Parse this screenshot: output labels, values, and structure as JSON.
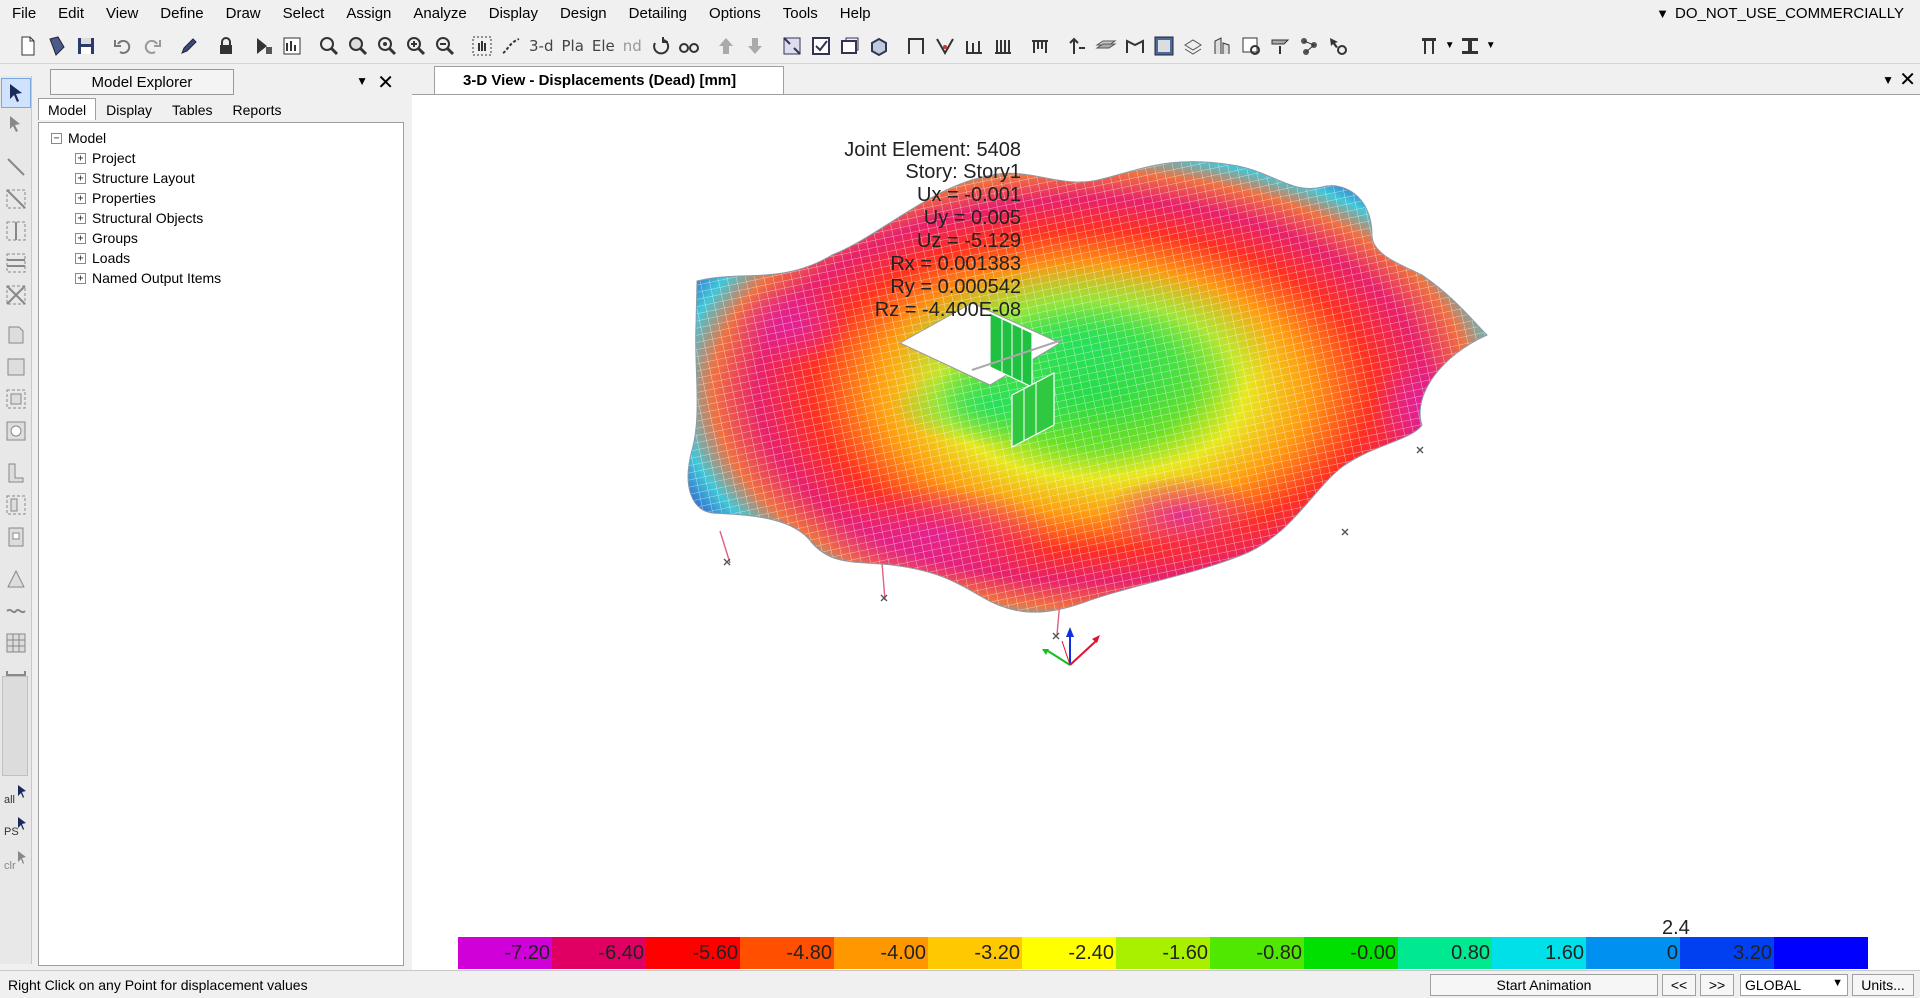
{
  "menu": {
    "items": [
      "File",
      "Edit",
      "View",
      "Define",
      "Draw",
      "Select",
      "Assign",
      "Analyze",
      "Display",
      "Design",
      "Detailing",
      "Options",
      "Tools",
      "Help"
    ],
    "right_label": "DO_NOT_USE_COMMERCIALLY"
  },
  "toolbar": {
    "view_3d_label": "3-d",
    "plan_label": "Pla",
    "elev_label": "Ele",
    "nd_label": "nd"
  },
  "left_tools": {
    "all_label": "all",
    "ps_label": "PS",
    "clr_label": "clr"
  },
  "explorer": {
    "title": "Model Explorer",
    "tabs": [
      "Model",
      "Display",
      "Tables",
      "Reports"
    ],
    "active_tab": "Model",
    "tree_root": "Model",
    "tree_children": [
      "Project",
      "Structure Layout",
      "Properties",
      "Structural Objects",
      "Groups",
      "Loads",
      "Named Output Items"
    ]
  },
  "view": {
    "tab_title": "3-D View   - Displacements (Dead)  [mm]"
  },
  "joint_info": {
    "lines": [
      "Joint Element: 5408",
      "Story: Story1",
      "Ux = -0.001",
      "Uy =  0.005",
      "Uz = -5.129",
      "Rx =  0.001383",
      "Ry =  0.000542",
      "Rz = -4.400E-08"
    ]
  },
  "legend": {
    "top_label": "2.4",
    "segments": [
      {
        "label": "-7.20",
        "color": "#d000d8"
      },
      {
        "label": "-6.40",
        "color": "#e00064"
      },
      {
        "label": "-5.60",
        "color": "#ff0000"
      },
      {
        "label": "-4.80",
        "color": "#ff5000"
      },
      {
        "label": "-4.00",
        "color": "#ff9800"
      },
      {
        "label": "-3.20",
        "color": "#ffc800"
      },
      {
        "label": "-2.40",
        "color": "#ffff00"
      },
      {
        "label": "-1.60",
        "color": "#a8f000"
      },
      {
        "label": "-0.80",
        "color": "#50e800"
      },
      {
        "label": "-0.00",
        "color": "#00e000"
      },
      {
        "label": "0.80",
        "color": "#00e890"
      },
      {
        "label": "1.60",
        "color": "#00e0e8"
      },
      {
        "label": "0",
        "color": "#0090f0"
      },
      {
        "label": "3.20",
        "color": "#0040f0"
      },
      {
        "label": "",
        "color": "#0000ff"
      }
    ]
  },
  "status": {
    "message": "Right Click on any Point for displacement values",
    "start_animation": "Start Animation",
    "prev": "<<",
    "next": ">>",
    "coord_system": "GLOBAL",
    "units": "Units..."
  }
}
